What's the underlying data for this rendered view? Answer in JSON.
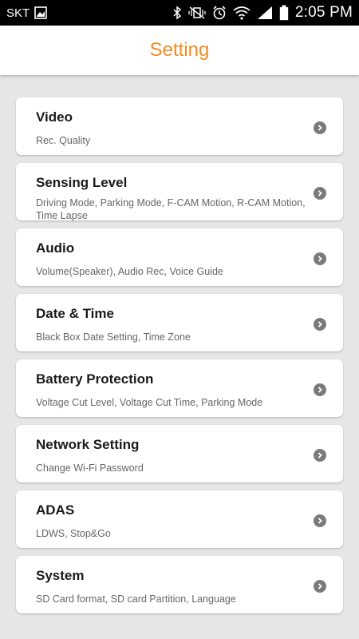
{
  "status_bar": {
    "carrier": "SKT",
    "time": "2:05 PM",
    "icons": [
      "image-icon",
      "bluetooth-icon",
      "vibrate-mute-icon",
      "alarm-icon",
      "wifi-icon",
      "signal-icon",
      "battery-icon"
    ]
  },
  "header": {
    "title": "Setting"
  },
  "colors": {
    "accent": "#f28c1f",
    "background": "#e6e6e6",
    "card": "#ffffff"
  },
  "items": [
    {
      "title": "Video",
      "desc": "Rec. Quality"
    },
    {
      "title": "Sensing Level",
      "desc": "Driving Mode, Parking Mode, F-CAM Motion, R-CAM Motion, Time Lapse"
    },
    {
      "title": "Audio",
      "desc": "Volume(Speaker), Audio Rec, Voice Guide"
    },
    {
      "title": "Date & Time",
      "desc": "Black Box Date Setting, Time Zone"
    },
    {
      "title": "Battery Protection",
      "desc": "Voltage Cut Level, Voltage Cut Time, Parking Mode"
    },
    {
      "title": "Network Setting",
      "desc": "Change Wi-Fi Password"
    },
    {
      "title": "ADAS",
      "desc": "LDWS, Stop&Go"
    },
    {
      "title": "System",
      "desc": "SD Card format, SD card Partition, Language"
    }
  ]
}
